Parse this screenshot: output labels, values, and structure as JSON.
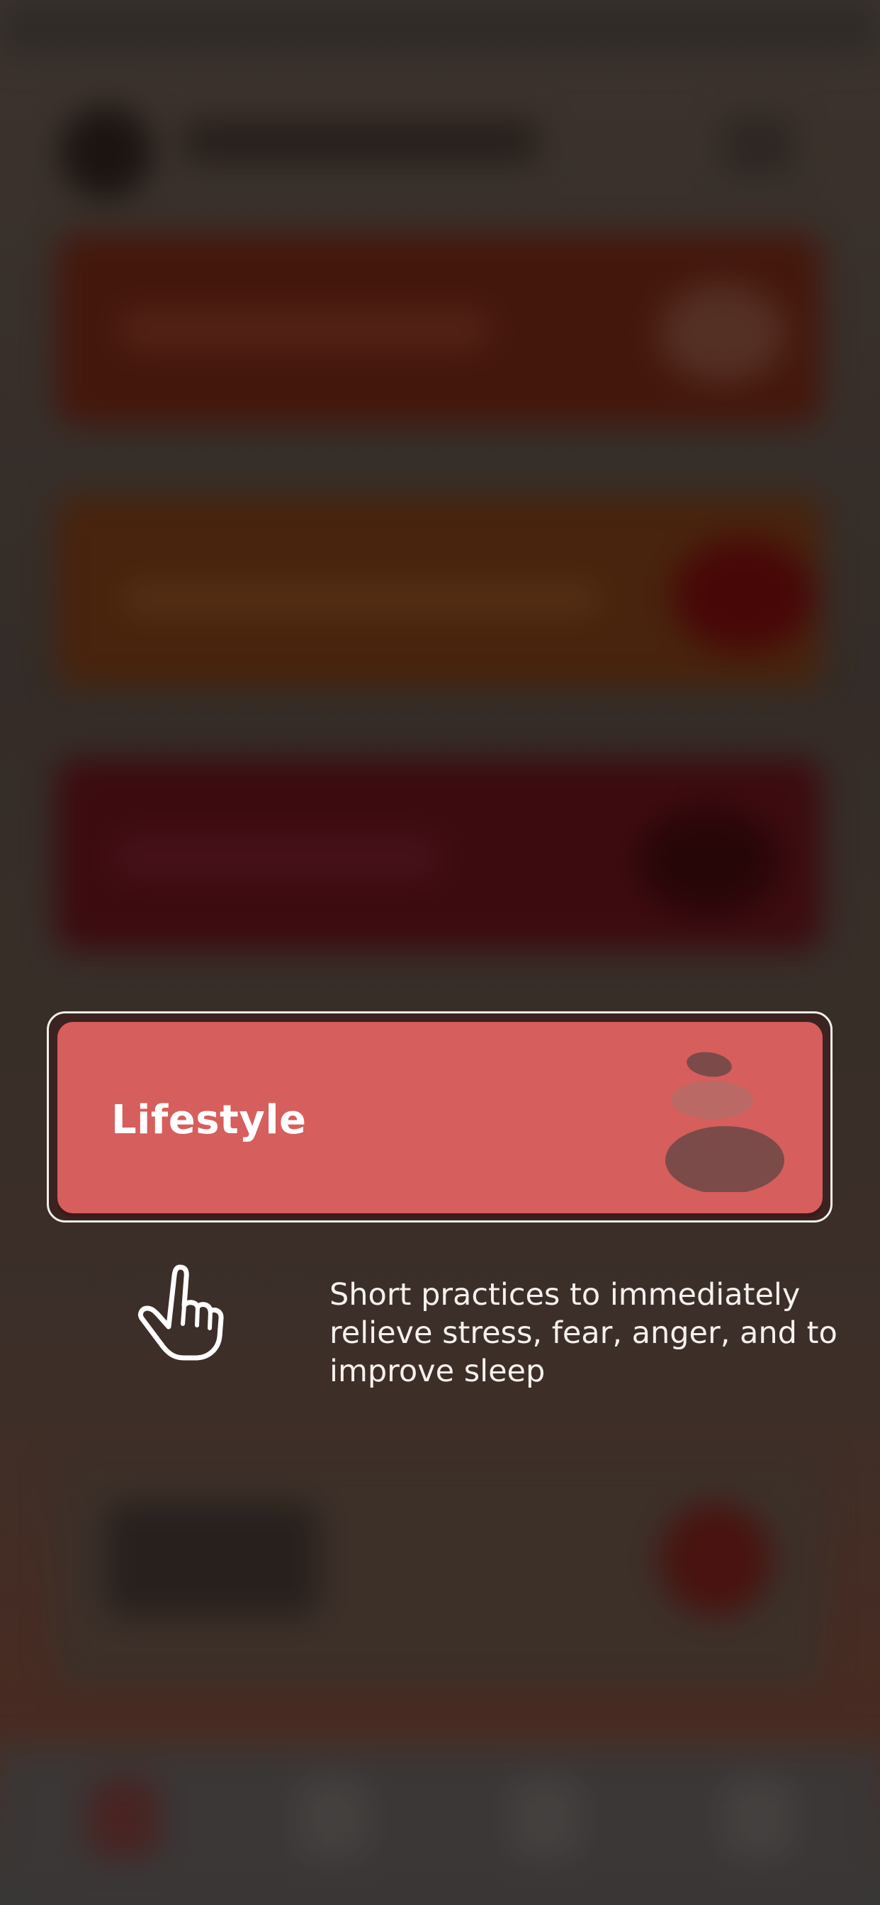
{
  "highlight_card": {
    "title": "Lifestyle",
    "icon": "stacked-stones-icon"
  },
  "hint": {
    "icon": "pointing-hand-icon",
    "description": "Short practices to immediately relieve stress, fear, anger, and to improve sleep"
  },
  "colors": {
    "card_fill": "#d65e5c",
    "frame_border": "#f3eeea",
    "stones": "#7b4b49",
    "text": "#ffffff"
  }
}
